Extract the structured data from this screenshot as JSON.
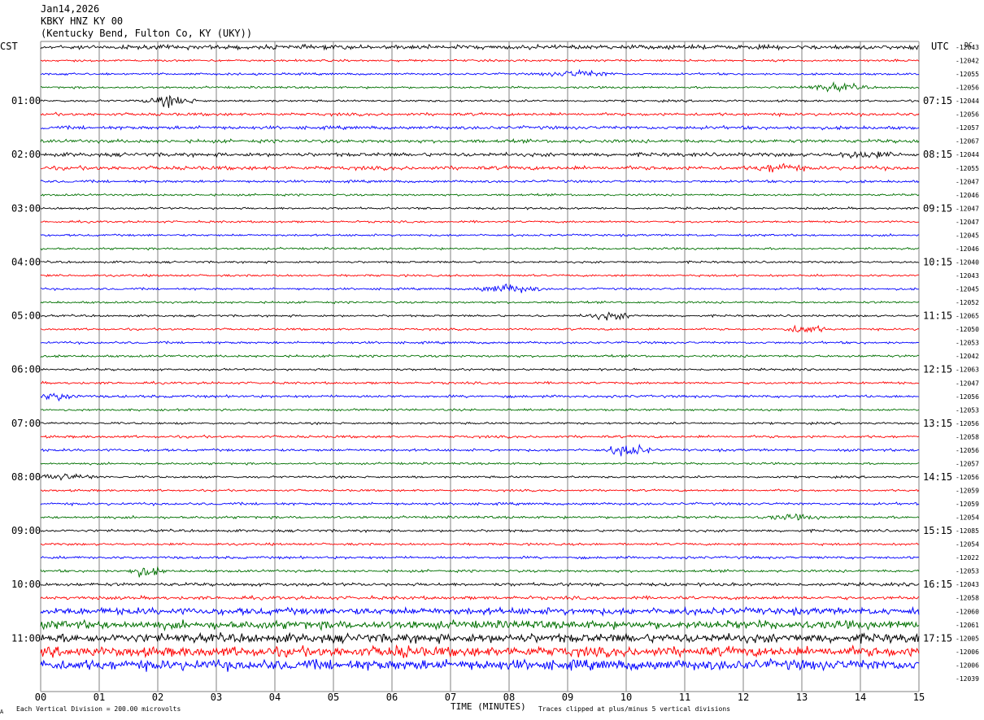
{
  "header": {
    "date": "Jan14,2026",
    "station": "KBKY HNZ KY 00",
    "location": "(Kentucky Bend, Fulton Co, KY (UKY))"
  },
  "axes": {
    "left_label": "CST",
    "right_label": "UTC",
    "right_corner_label": "DC",
    "xlabel": "TIME (MINUTES)",
    "x_ticks": [
      "00",
      "01",
      "02",
      "03",
      "04",
      "05",
      "06",
      "07",
      "08",
      "09",
      "10",
      "11",
      "12",
      "13",
      "14",
      "15"
    ],
    "left_times": [
      "01:00",
      "02:00",
      "03:00",
      "04:00",
      "05:00",
      "06:00",
      "07:00",
      "08:00",
      "09:00",
      "10:00",
      "11:00"
    ],
    "right_times": [
      "07:15",
      "08:15",
      "09:15",
      "10:15",
      "11:15",
      "12:15",
      "13:15",
      "14:15",
      "15:15",
      "16:15",
      "17:15"
    ]
  },
  "footer": {
    "division_note": "Each Vertical Division =  200.00 microvolts",
    "clip_note": "Traces clipped at plus/minus 5 vertical divisions",
    "corner_mark": "A"
  },
  "colors": {
    "trace_cycle": [
      "#000000",
      "#ff0000",
      "#0000ff",
      "#007000"
    ],
    "grid": "#808080",
    "text": "#000000"
  },
  "chart_data": {
    "type": "line",
    "title": "KBKY HNZ KY 00",
    "xlabel": "TIME (MINUTES)",
    "xlim": [
      0,
      15
    ],
    "minutes_per_line": 15,
    "line_count": 47,
    "dc_offsets": [
      "-12043",
      "-12042",
      "-12055",
      "-12056",
      "-12044",
      "-12056",
      "-12057",
      "-12067",
      "-12044",
      "-12055",
      "-12047",
      "-12046",
      "-12047",
      "-12047",
      "-12045",
      "-12046",
      "-12040",
      "-12043",
      "-12045",
      "-12052",
      "-12065",
      "-12050",
      "-12053",
      "-12042",
      "-12063",
      "-12047",
      "-12056",
      "-12053",
      "-12056",
      "-12058",
      "-12056",
      "-12057",
      "-12056",
      "-12059",
      "-12059",
      "-12054",
      "-12085",
      "-12054",
      "-12022",
      "-12053",
      "-12043",
      "-12058",
      "-12060",
      "-12061",
      "-12005",
      "-12006",
      "-12006",
      "-12039"
    ],
    "activity_level": [
      2,
      1,
      1,
      1,
      1,
      1.4,
      1.6,
      1.6,
      1.8,
      1.8,
      1.2,
      1,
      1,
      1,
      1,
      1,
      1,
      1,
      1,
      1,
      1,
      1,
      1.1,
      1.1,
      1,
      1.1,
      1.2,
      1,
      1,
      1.2,
      1.2,
      1,
      1,
      1,
      1.2,
      1.2,
      1.2,
      1.1,
      1.2,
      1.2,
      1.5,
      1.6,
      3.2,
      3.8,
      4.2,
      4.6,
      4.8,
      5.2
    ]
  }
}
